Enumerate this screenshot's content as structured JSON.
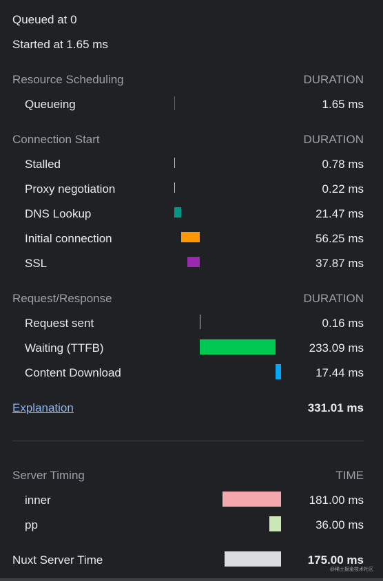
{
  "queued_at": "Queued at 0",
  "started_at": "Started at 1.65 ms",
  "sections": [
    {
      "title": "Resource Scheduling",
      "col": "DURATION",
      "rows": [
        {
          "label": "Queueing",
          "value": "1.65 ms",
          "color": "#5f6368"
        }
      ]
    },
    {
      "title": "Connection Start",
      "col": "DURATION",
      "rows": [
        {
          "label": "Stalled",
          "value": "0.78 ms",
          "color": "#bdc1c6"
        },
        {
          "label": "Proxy negotiation",
          "value": "0.22 ms",
          "color": "#bdc1c6"
        },
        {
          "label": "DNS Lookup",
          "value": "21.47 ms",
          "color": "#009688"
        },
        {
          "label": "Initial connection",
          "value": "56.25 ms",
          "color": "#ff9800"
        },
        {
          "label": "SSL",
          "value": "37.87 ms",
          "color": "#9c27b0"
        }
      ]
    },
    {
      "title": "Request/Response",
      "col": "DURATION",
      "rows": [
        {
          "label": "Request sent",
          "value": "0.16 ms",
          "color": "#bdc1c6"
        },
        {
          "label": "Waiting (TTFB)",
          "value": "233.09 ms",
          "color": "#00c853"
        },
        {
          "label": "Content Download",
          "value": "17.44 ms",
          "color": "#03a9f4"
        }
      ]
    }
  ],
  "explanation": "Explanation",
  "total": "331.01 ms",
  "server": {
    "title": "Server Timing",
    "col": "TIME",
    "rows": [
      {
        "label": "inner",
        "value": "181.00 ms",
        "color": "#f2a8ad"
      },
      {
        "label": "pp",
        "value": "36.00 ms",
        "color": "#cce8b5"
      }
    ],
    "total_label": "Nuxt Server Time",
    "total_value": "175.00 ms",
    "total_color": "#dadce0"
  },
  "watermark": "@稀土掘金技术社区"
}
